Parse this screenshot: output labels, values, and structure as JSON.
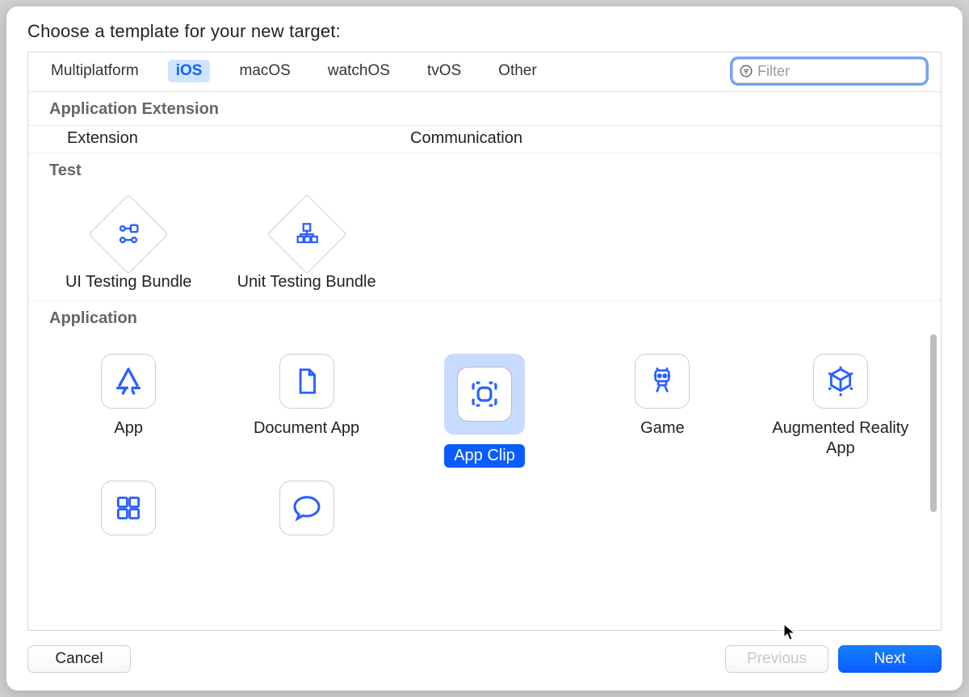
{
  "title": "Choose a template for your new target:",
  "tabs": {
    "platform": [
      "Multiplatform",
      "iOS",
      "macOS",
      "watchOS",
      "tvOS",
      "Other"
    ],
    "selected": "iOS"
  },
  "filter": {
    "placeholder": "Filter",
    "value": ""
  },
  "sections": [
    {
      "header": "Application Extension",
      "items": [
        "Extension",
        "Communication"
      ]
    },
    {
      "header": "Test",
      "grid": [
        {
          "id": "ui-testing-bundle",
          "label": "UI Testing Bundle",
          "icon": "ui-test",
          "shape": "diamond"
        },
        {
          "id": "unit-testing-bundle",
          "label": "Unit Testing Bundle",
          "icon": "unit-test",
          "shape": "diamond"
        }
      ]
    },
    {
      "header": "Application",
      "grid": [
        {
          "id": "app",
          "label": "App",
          "icon": "app-store"
        },
        {
          "id": "document-app",
          "label": "Document App",
          "icon": "document"
        },
        {
          "id": "app-clip",
          "label": "App Clip",
          "icon": "app-clip",
          "selected": true
        },
        {
          "id": "game",
          "label": "Game",
          "icon": "robot"
        },
        {
          "id": "ar-app",
          "label": "Augmented Reality App",
          "icon": "ar-cube"
        },
        {
          "id": "sticker-pack",
          "label": "",
          "icon": "four-squares"
        },
        {
          "id": "imessage-app",
          "label": "",
          "icon": "speech-bubble"
        }
      ]
    }
  ],
  "buttons": {
    "cancel": "Cancel",
    "previous": "Previous",
    "next": "Next"
  }
}
